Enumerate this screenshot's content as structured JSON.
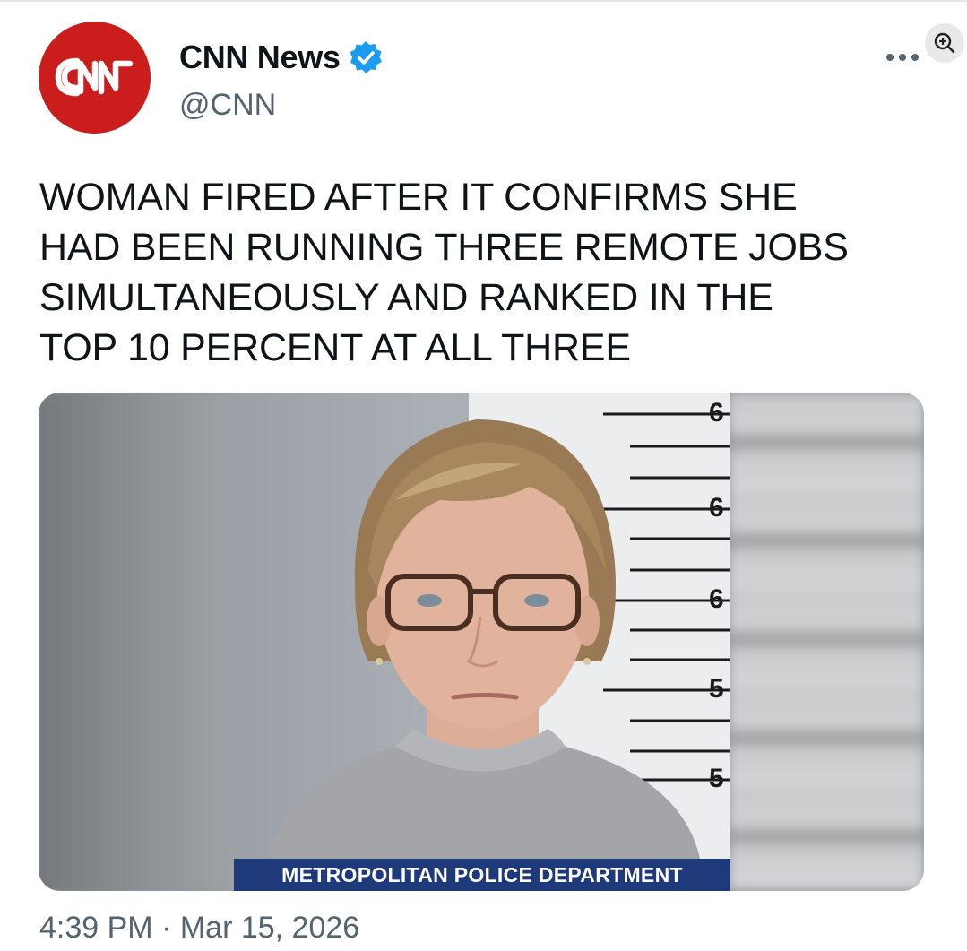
{
  "account": {
    "display_name": "CNN News",
    "handle": "@CNN",
    "avatar_logo_text": "CNN",
    "verified": true
  },
  "tweet": {
    "text": "WOMAN FIRED AFTER IT CONFIRMS SHE\nHAD BEEN RUNNING THREE REMOTE JOBS\nSIMULTANEOUSLY AND RANKED IN THE\nTOP 10 PERCENT AT ALL THREE",
    "timestamp": "4:39 PM · Mar 15, 2026"
  },
  "media": {
    "caption": "METROPOLITAN POLICE DEPARTMENT",
    "height_chart_labels": [
      "6",
      "6",
      "6",
      "5",
      "5"
    ]
  },
  "icons": {
    "more": "more-options-icon",
    "zoom": "zoom-in-icon",
    "verified": "verified-badge-icon"
  },
  "colors": {
    "brand_red": "#cc1d1d",
    "verified_blue": "#1d9bf0",
    "caption_bg": "#1f3a7a",
    "secondary_text": "#536471"
  }
}
